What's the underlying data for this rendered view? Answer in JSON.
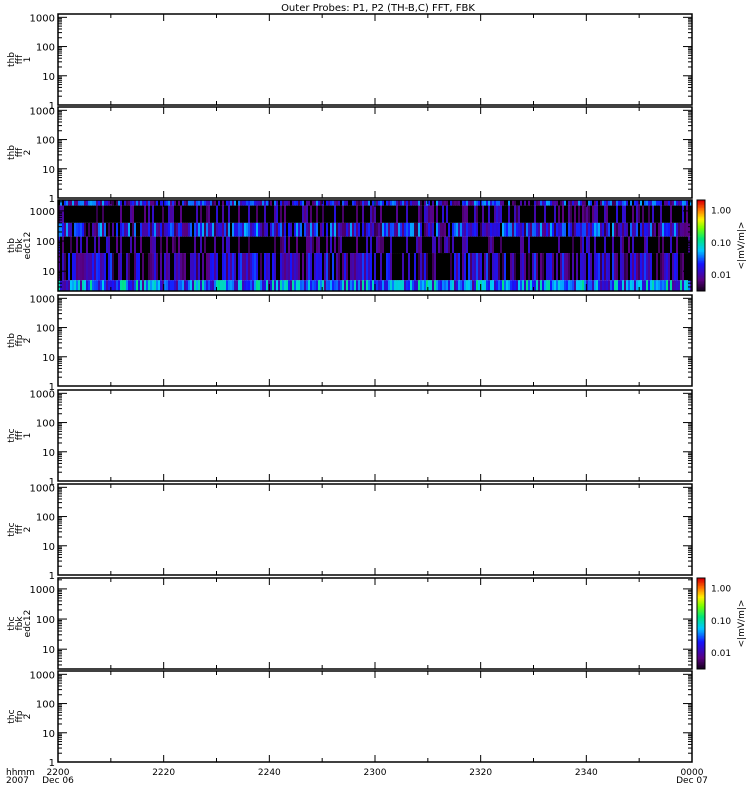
{
  "chart_data": {
    "type": "heatmap",
    "title": "Outer Probes: P1, P2 (TH-B,C) FFT, FBK",
    "x_axis": {
      "label_lines": [
        "hhmm",
        "2007"
      ],
      "ticks": [
        {
          "label": "2200",
          "sub": "Dec 06"
        },
        {
          "label": "2220",
          "sub": ""
        },
        {
          "label": "2240",
          "sub": ""
        },
        {
          "label": "2300",
          "sub": ""
        },
        {
          "label": "2320",
          "sub": ""
        },
        {
          "label": "2340",
          "sub": ""
        },
        {
          "label": "0000",
          "sub": "Dec 07"
        }
      ],
      "range_minutes": [
        0,
        120
      ]
    },
    "panels": [
      {
        "label": [
          "thb",
          "fff",
          "1"
        ],
        "yscale": "log",
        "ylim": [
          1,
          1300
        ],
        "yticks": [
          "1",
          "10",
          "100",
          "1000"
        ],
        "has_data": false
      },
      {
        "label": [
          "thb",
          "fff",
          "2"
        ],
        "yscale": "log",
        "ylim": [
          1,
          1300
        ],
        "yticks": [
          "1",
          "10",
          "100",
          "1000"
        ],
        "has_data": false
      },
      {
        "label": [
          "thb",
          "fbk",
          "edc12"
        ],
        "yscale": "log",
        "ylim": [
          2.2,
          2300
        ],
        "yticks": [
          "10",
          "100",
          "1000"
        ],
        "has_data": true,
        "bands_hz": [
          [
            1500,
            2300
          ],
          [
            400,
            1500
          ],
          [
            140,
            400
          ],
          [
            40,
            140
          ],
          [
            5,
            40
          ],
          [
            2.2,
            5
          ]
        ],
        "band_typical_mVm": [
          0.012,
          0.004,
          0.013,
          0.004,
          0.007,
          0.03
        ],
        "colorbar": {
          "label": "<|mV/m|>",
          "scale": "log",
          "range": [
            0.003,
            2.0
          ],
          "ticks": [
            "1.00",
            "0.10",
            "0.01"
          ]
        }
      },
      {
        "label": [
          "thb",
          "ffp",
          "2"
        ],
        "yscale": "log",
        "ylim": [
          1,
          1300
        ],
        "yticks": [
          "1",
          "10",
          "100",
          "1000"
        ],
        "has_data": false
      },
      {
        "label": [
          "thc",
          "fff",
          "1"
        ],
        "yscale": "log",
        "ylim": [
          1,
          1300
        ],
        "yticks": [
          "1",
          "10",
          "100",
          "1000"
        ],
        "has_data": false
      },
      {
        "label": [
          "thc",
          "fff",
          "2"
        ],
        "yscale": "log",
        "ylim": [
          1,
          1300
        ],
        "yticks": [
          "1",
          "10",
          "100",
          "1000"
        ],
        "has_data": false
      },
      {
        "label": [
          "thc",
          "fbk",
          "edc12"
        ],
        "yscale": "log",
        "ylim": [
          2.2,
          2300
        ],
        "yticks": [
          "10",
          "100",
          "1000"
        ],
        "has_data": false,
        "colorbar": {
          "label": "<|mV/m|>",
          "scale": "log",
          "range": [
            0.003,
            2.0
          ],
          "ticks": [
            "1.00",
            "0.10",
            "0.01"
          ]
        }
      },
      {
        "label": [
          "thc",
          "ffp",
          "2"
        ],
        "yscale": "log",
        "ylim": [
          1,
          1300
        ],
        "yticks": [
          "1",
          "10",
          "100",
          "1000"
        ],
        "has_data": false
      }
    ]
  }
}
